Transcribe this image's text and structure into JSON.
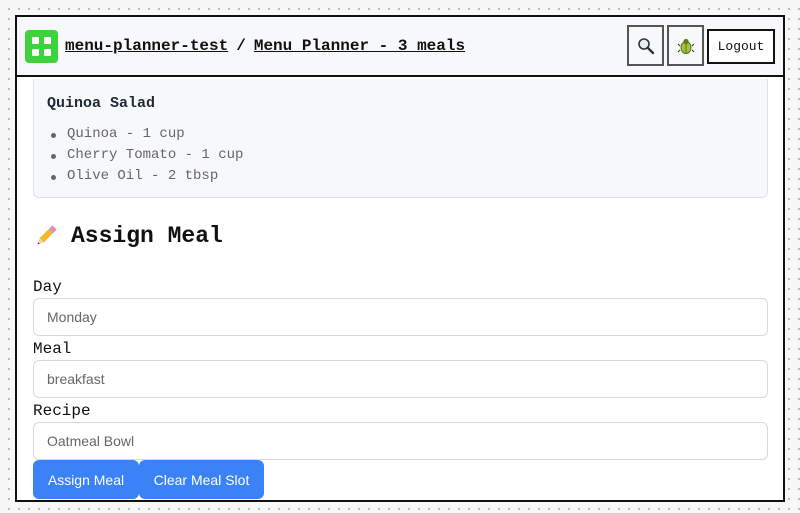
{
  "header": {
    "project_link": "menu-planner-test",
    "separator": "/",
    "page_link": "Menu Planner - 3 meals",
    "logout_label": "Logout",
    "icons": {
      "search": "search-icon",
      "debug": "bug-icon",
      "logo": "app-logo-icon"
    },
    "logo_color": "#3ed33d"
  },
  "recipe_card": {
    "title": "Quinoa Salad",
    "ingredients": [
      "Quinoa - 1 cup",
      "Cherry Tomato - 1 cup",
      "Olive Oil - 2 tbsp"
    ]
  },
  "assign_meal": {
    "title": "Assign Meal",
    "title_icon": "pencil-icon",
    "fields": [
      {
        "label": "Day",
        "value": "Monday"
      },
      {
        "label": "Meal",
        "value": "breakfast"
      },
      {
        "label": "Recipe",
        "value": "Oatmeal Bowl"
      }
    ],
    "assign_label": "Assign Meal",
    "clear_label": "Clear Meal Slot",
    "button_color": "#3b82f6"
  }
}
